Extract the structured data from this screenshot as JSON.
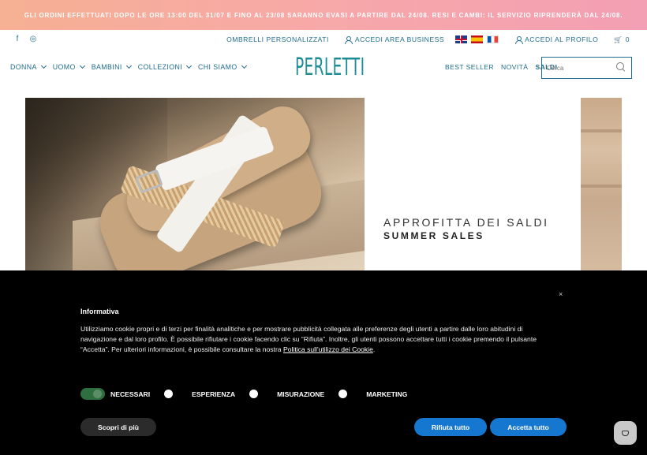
{
  "announcement": "GLI ORDINI EFFETTUATI DOPO LE ORE 13:00 DEL 31/07 E FINO AL 23/08 SARANNO EVASI A PARTIRE DAL 24/08. RESI E CAMBI: IL SERVIZIO RIPRENDERÀ DAL 24/08.",
  "social": {
    "facebook_icon": "f",
    "instagram_icon": "◎"
  },
  "toplinks": {
    "umbrellas": "OMBRELLI PERSONALIZZATI",
    "business": "ACCEDI AREA BUSINESS",
    "profile": "ACCEDI AL PROFILO",
    "cart_count": "0",
    "cart_icon": "🛒"
  },
  "nav": {
    "items": [
      "DONNA",
      "UOMO",
      "BAMBINI",
      "COLLEZIONI",
      "CHI SIAMO"
    ],
    "logo": "PERLETTI",
    "right": [
      "BEST SELLER",
      "NOVITÀ",
      "SALDI"
    ],
    "search_placeholder": "Cerca"
  },
  "hero": {
    "line1": "APPROFITTA DEI SALDI",
    "line2": "SUMMER SALES"
  },
  "cookie": {
    "close": "×",
    "title": "Informativa",
    "body": "Utilizziamo cookie propri e di terzi per finalità analitiche e per mostrare pubblicità collegata alle preferenze degli utenti a partire dalle loro abitudini di navigazione e dal loro profilo. È possibile rifiutare i cookie facendo clic su “Rifiuta”. Inoltre, gli utenti possono accettare tutti i cookie premendo il pulsante “Accetta”. Per ulteriori informazioni, è possibile consultare la nostra ",
    "policy_link": "Politica sull'utilizzo dei Cookie",
    "body_end": ".",
    "options": [
      "NECESSARI",
      "ESPERIENZA",
      "MISURAZIONE",
      "MARKETING"
    ],
    "more": "Scopri di più",
    "reject": "Rifiuta tutto",
    "accept": "Accetta tutto"
  }
}
